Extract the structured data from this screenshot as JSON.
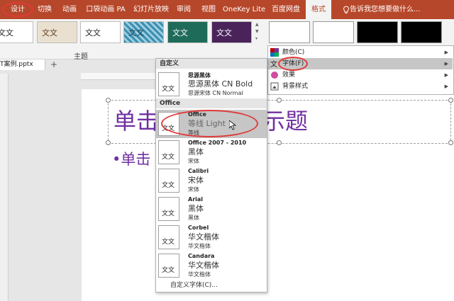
{
  "tabs": [
    {
      "label": "设计"
    },
    {
      "label": "切换"
    },
    {
      "label": "动画"
    },
    {
      "label": "口袋动画 PA"
    },
    {
      "label": "幻灯片放映"
    },
    {
      "label": "审阅"
    },
    {
      "label": "视图"
    },
    {
      "label": "OneKey Lite"
    },
    {
      "label": "百度网盘"
    },
    {
      "label": "格式"
    },
    {
      "label": "告诉我您想要做什么..."
    }
  ],
  "ribbon": {
    "themes_group_label": "主题",
    "theme_sample_text": "文文"
  },
  "document": {
    "tab_name": "T案例.pptx",
    "new_tab_symbol": "+"
  },
  "slide": {
    "title_left": "单击",
    "title_right": "示题",
    "bullet": "•单击"
  },
  "font_panel": {
    "sections": [
      {
        "label": "自定义"
      },
      {
        "label": "Office"
      }
    ],
    "sample": "文文",
    "fonts": [
      {
        "name": "思源黑体",
        "heading": "思源黑体 CN Bold",
        "body": "思源宋体 CN Normal"
      },
      {
        "name": "Office",
        "heading": "等线 Light",
        "body": "等线"
      },
      {
        "name": "Office 2007 - 2010",
        "heading": "黑体",
        "body": "宋体"
      },
      {
        "name": "Calibri",
        "heading": "宋体",
        "body": "宋体"
      },
      {
        "name": "Arial",
        "heading": "黑体",
        "body": "黑体"
      },
      {
        "name": "Corbel",
        "heading": "华文楷体",
        "body": "华文楷体"
      },
      {
        "name": "Candara",
        "heading": "华文楷体",
        "body": "华文楷体"
      }
    ],
    "custom_link": "自定义字体(C)...",
    "grip": "....."
  },
  "variants_menu": {
    "items": [
      {
        "label": "颜色(C)",
        "icon": "colors-icon"
      },
      {
        "label": "字体(F)",
        "icon": "fonts-icon"
      },
      {
        "label": "效果",
        "icon": "effects-icon"
      },
      {
        "label": "背景样式",
        "icon": "background-styles-icon"
      }
    ]
  },
  "colors": {
    "accent": "#b7472a",
    "highlight_ring": "#e03a3a",
    "slide_text": "#7030a0"
  }
}
